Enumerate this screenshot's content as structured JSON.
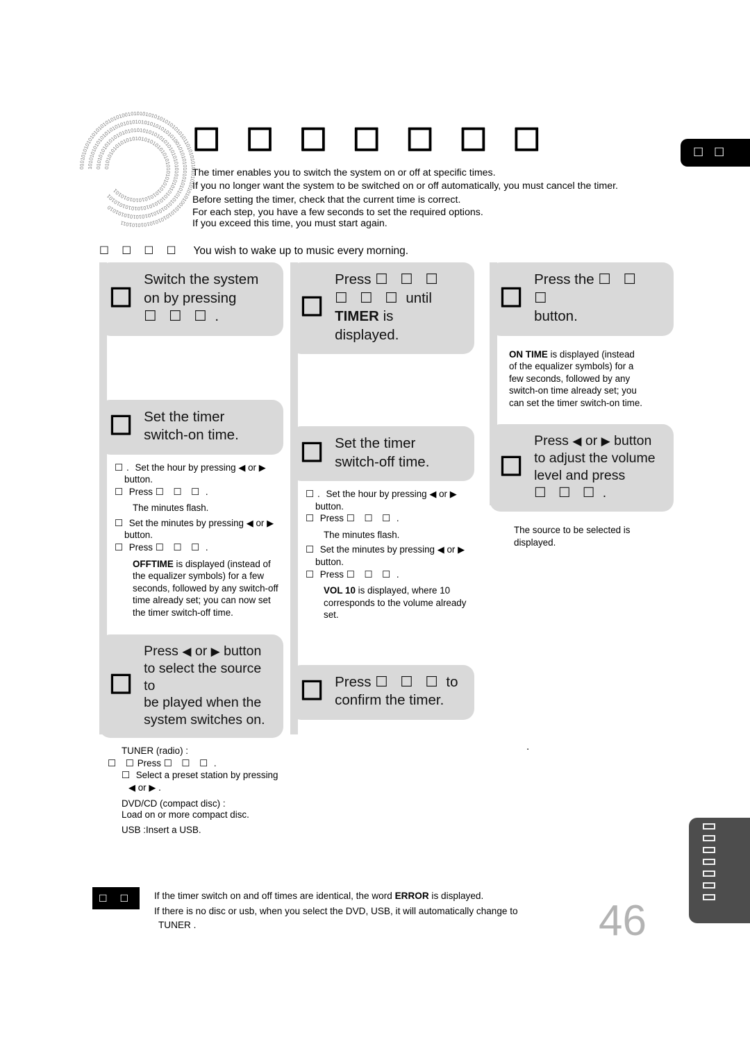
{
  "header": {
    "title": "☐ ☐ ☐ ☐ ☐ ☐ ☐",
    "corner_tab_label": "☐ ☐",
    "corner_tab_color": "#000000"
  },
  "intro": {
    "lines": [
      "The timer enables you to switch the system on or off at specific times.",
      "If you no longer want the system to be switched on or off automatically, you must cancel the timer.",
      "Before setting the timer, check that the current time is correct.",
      "For each step, you have a few seconds to set the required options.",
      "If you exceed this time, you must start again."
    ]
  },
  "example": {
    "label": "☐ ☐ ☐ ☐",
    "text": "You wish to wake up to music every morning."
  },
  "steps": {
    "step1": {
      "number": "☐",
      "line1": "Switch the system",
      "line2": "on by pressing",
      "button": "☐ ☐ ☐",
      "trailing": "."
    },
    "step2": {
      "number": "☐",
      "press": "Press",
      "button_line1": "☐ ☐ ☐",
      "button_line2": "☐ ☐ ☐",
      "until": "until",
      "display_word": "TIMER",
      "is": "is",
      "displayed": "displayed."
    },
    "step3": {
      "number": "☐",
      "line1_pre": "Press the",
      "button": "☐ ☐ ☐",
      "line2": "button.",
      "detail": [
        {
          "bold": "ON TIME",
          "rest": " is displayed (instead"
        },
        {
          "bold": "",
          "rest": "of the equalizer symbols) for a"
        },
        {
          "bold": "",
          "rest": "few seconds, followed by any"
        },
        {
          "bold": "",
          "rest": "switch-on time already set; you"
        },
        {
          "bold": "",
          "rest": "can set the timer switch-on time."
        }
      ]
    },
    "step4": {
      "number": "☐",
      "line1": "Set the timer",
      "line2": "switch-on time.",
      "detail": {
        "b1_marker": "☐.",
        "b1": "Set the hour by pressing",
        "b1_arrows": "or",
        "b1_end": "button.",
        "b2_marker": "☐",
        "b2_press": "Press",
        "b2_button": "☐ ☐ ☐",
        "b2_end": ".",
        "flash": "The minutes flash.",
        "b3_marker": "☐",
        "b3": "Set the minutes by pressing",
        "b3_arrows": "or",
        "b3_end": "button.",
        "b4_marker": "☐",
        "b4_press": "Press",
        "b4_button": "☐ ☐ ☐",
        "b4_end": ".",
        "note_bold": "OFFTIME",
        "note_rest": " is displayed (instead of the equalizer symbols) for a few seconds, followed by any switch-off time already set; you can now set the timer switch-off time."
      }
    },
    "step5": {
      "number": "☐",
      "line1": "Set the timer",
      "line2": "switch-off time.",
      "detail": {
        "b1_marker": "☐.",
        "b1": "Set the hour by pressing",
        "b1_arrows": "or",
        "b1_end": "button.",
        "b2_marker": "☐",
        "b2_press": "Press",
        "b2_button": "☐ ☐ ☐",
        "b2_end": ".",
        "flash": "The minutes flash.",
        "b3_marker": "☐",
        "b3": "Set the minutes by pressing",
        "b3_arrows": "or",
        "b3_end": "button.",
        "b4_marker": "☐",
        "b4_press": "Press",
        "b4_button": "☐ ☐ ☐",
        "b4_end": ".",
        "note_bold": "VOL 10",
        "note_rest": " is displayed, where 10 corresponds to the volume already set."
      }
    },
    "step6": {
      "number": "☐",
      "line1_pre": "Press",
      "line1_mid": "or",
      "line1_end": "button",
      "line2": "to adjust the volume",
      "line3": "level and press",
      "button": "☐ ☐ ☐",
      "trailing": ".",
      "detail": [
        "The source to be selected is",
        "displayed."
      ]
    },
    "step7": {
      "number": "☐",
      "line1_pre": "Press",
      "line1_mid": "or",
      "line1_end": "button",
      "line2": "to select the source to",
      "line3": "be played when the",
      "line4": "system switches on.",
      "detail": {
        "tuner_title": "TUNER (radio) :",
        "tuner_marker": "☐ ☐",
        "tuner_press": "Press",
        "tuner_button": "☐ ☐ ☐",
        "tuner_end": ".",
        "preset_marker": "☐",
        "preset": "Select a preset station by pressing",
        "preset_arrows": "or",
        "preset_end": ".",
        "dvd_title": "DVD/CD (compact disc) :",
        "dvd_text": "Load on or more compact disc.",
        "usb_text": "USB :Insert a USB."
      }
    },
    "step8": {
      "number": "☐",
      "line1_pre": "Press",
      "button": "☐ ☐ ☐",
      "line1_end": "to",
      "line2": "confirm the timer.",
      "stray": "."
    }
  },
  "bottom_note": {
    "badge": "☐ ☐",
    "line1_pre": "If the timer switch on and off times are identical, the word ",
    "line1_bold": "ERROR",
    "line1_post": " is displayed.",
    "line2": "If there is no disc or usb, when you select the  DVD, USB, it will automatically change to",
    "line3": "TUNER ."
  },
  "side_tab": {
    "glyph_count": 7,
    "color": "#4d4d4d"
  },
  "footer": {
    "page_number": "46",
    "page_number_color": "#b3b3b3"
  },
  "icons": {
    "left_arrow": "◀",
    "right_arrow": "▶"
  },
  "theme": {
    "step_box_bg": "#d9d9d9",
    "page_bg": "#ffffff"
  }
}
